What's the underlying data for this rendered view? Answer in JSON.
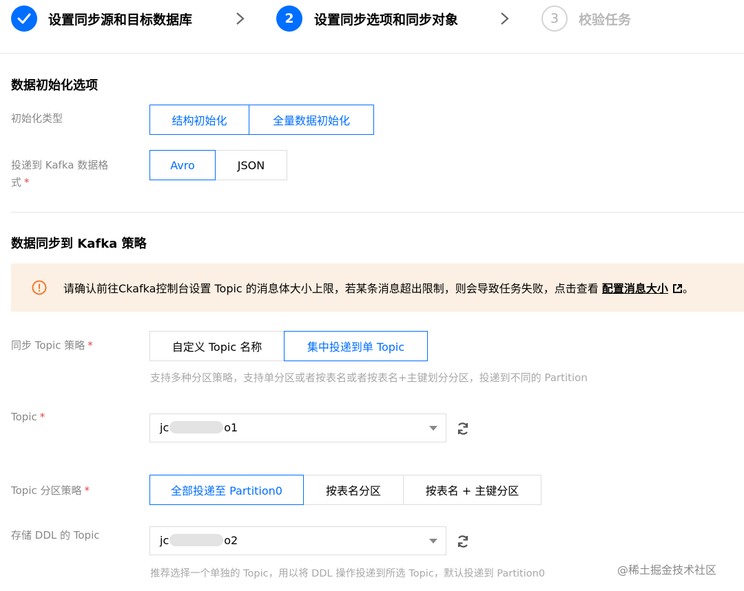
{
  "steps": [
    {
      "number": "1",
      "label": "设置同步源和目标数据库",
      "state": "done"
    },
    {
      "number": "2",
      "label": "设置同步选项和同步对象",
      "state": "active"
    },
    {
      "number": "3",
      "label": "校验任务",
      "state": "pending"
    }
  ],
  "init_section": {
    "title": "数据初始化选项",
    "init_type": {
      "label": "初始化类型",
      "options": [
        "结构初始化",
        "全量数据初始化"
      ]
    },
    "kafka_format": {
      "label_line1": "投递到 Kafka 数据格",
      "label_line2": "式",
      "required": "*",
      "options": [
        "Avro",
        "JSON"
      ],
      "selected": "Avro"
    }
  },
  "kafka_section": {
    "title": "数据同步到 Kafka 策略",
    "alert": {
      "text": "请确认前往Ckafka控制台设置 Topic 的消息体大小上限，若某条消息超出限制，则会导致任务失败，点击查看",
      "link": "配置消息大小",
      "end": "。"
    },
    "topic_strategy": {
      "label": "同步 Topic 策略",
      "required": "*",
      "options": [
        "自定义 Topic 名称",
        "集中投递到单 Topic"
      ],
      "selected": "集中投递到单 Topic",
      "help": "支持多种分区策略，支持单分区或者按表名或者按表名+主键划分分区，投递到不同的 Partition"
    },
    "topic": {
      "label": "Topic",
      "required": "*",
      "value_prefix": "jc",
      "value_suffix": "o1"
    },
    "partition_strategy": {
      "label": "Topic 分区策略",
      "required": "*",
      "options": [
        "全部投递至 Partition0",
        "按表名分区",
        "按表名 + 主键分区"
      ],
      "selected": "全部投递至 Partition0"
    },
    "ddl_topic": {
      "label": "存储 DDL 的 Topic",
      "value_prefix": "jc",
      "value_suffix": "o2",
      "help": "推荐选择一个单独的 Topic，用以将 DDL 操作投递到所选 Topic，默认投递到 Partition0"
    }
  },
  "watermark": "@稀土掘金技术社区",
  "colors": {
    "primary": "#006eff",
    "alert_bg": "#fcefe3",
    "alert_icon": "#f07a2a",
    "required": "#e54545"
  }
}
